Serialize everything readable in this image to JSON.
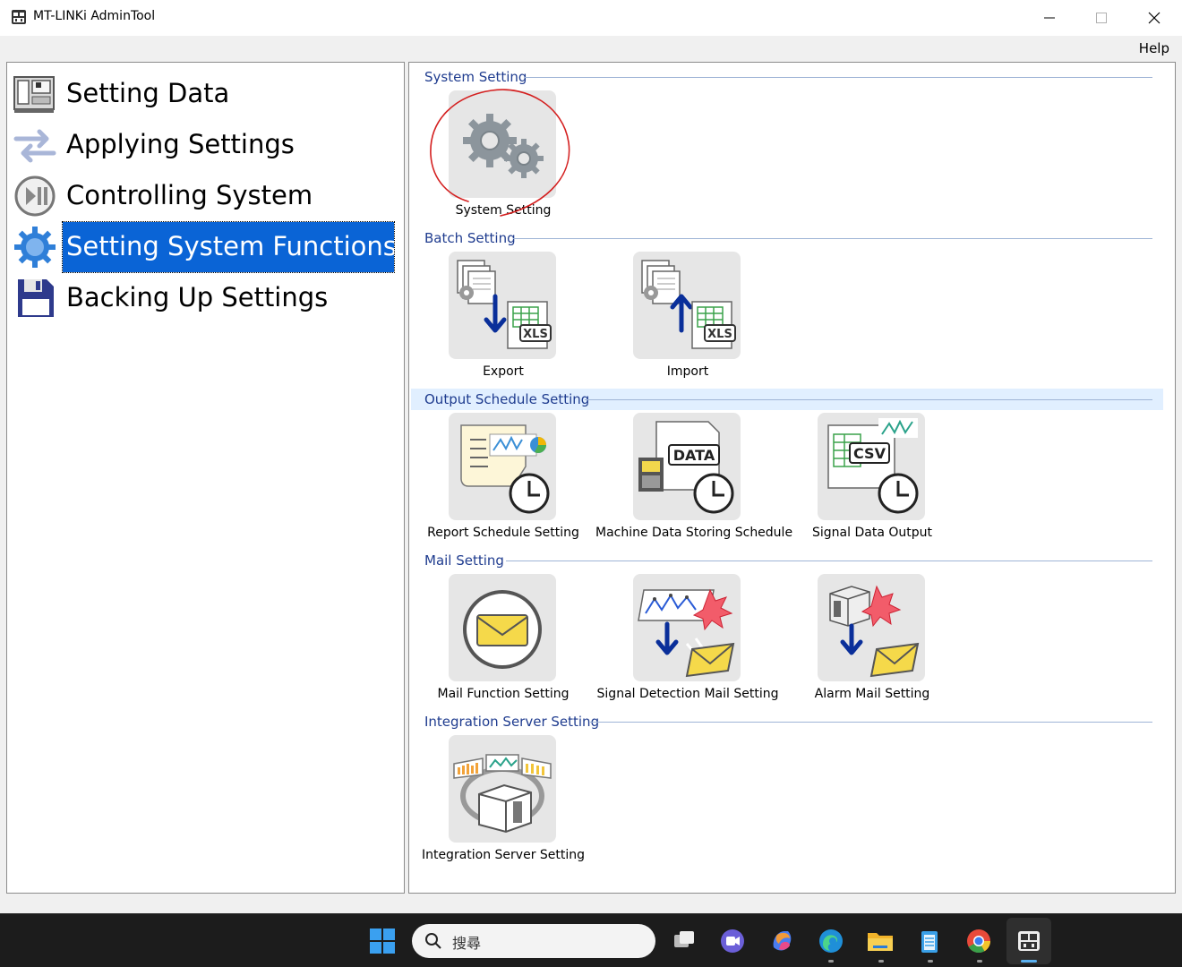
{
  "window": {
    "title": "MT-LINKi AdminTool",
    "menu_help": "Help"
  },
  "sidebar": {
    "items": [
      {
        "label": "Setting Data",
        "icon": "machine-icon",
        "selected": false
      },
      {
        "label": "Applying Settings",
        "icon": "transfer-arrows-icon",
        "selected": false
      },
      {
        "label": "Controlling System",
        "icon": "play-pause-icon",
        "selected": false
      },
      {
        "label": "Setting System Functions",
        "icon": "gear-icon",
        "selected": true
      },
      {
        "label": "Backing Up Settings",
        "icon": "floppy-disk-icon",
        "selected": false
      }
    ]
  },
  "main": {
    "sections": [
      {
        "title": "System Setting",
        "tiles": [
          {
            "label": "System Setting",
            "icon": "gears-icon"
          }
        ]
      },
      {
        "title": "Batch Setting",
        "tiles": [
          {
            "label": "Export",
            "icon": "export-xls-icon"
          },
          {
            "label": "Import",
            "icon": "import-xls-icon"
          }
        ]
      },
      {
        "title": "Output Schedule Setting",
        "tiles": [
          {
            "label": "Report Schedule Setting",
            "icon": "report-clock-icon"
          },
          {
            "label": "Machine Data Storing Schedule",
            "icon": "data-clock-icon"
          },
          {
            "label": "Signal Data Output",
            "icon": "csv-clock-icon"
          }
        ]
      },
      {
        "title": "Mail Setting",
        "tiles": [
          {
            "label": "Mail Function Setting",
            "icon": "envelope-icon"
          },
          {
            "label": "Signal Detection Mail Setting",
            "icon": "signal-mail-icon"
          },
          {
            "label": "Alarm Mail Setting",
            "icon": "alarm-mail-icon"
          }
        ]
      },
      {
        "title": "Integration Server Setting",
        "tiles": [
          {
            "label": "Integration Server Setting",
            "icon": "server-integration-icon"
          }
        ]
      }
    ]
  },
  "taskbar": {
    "search_placeholder": "搜尋"
  },
  "colors": {
    "selection": "#0a64d6",
    "section_title": "#1f3c8f",
    "annotation_circle": "#d42020"
  }
}
